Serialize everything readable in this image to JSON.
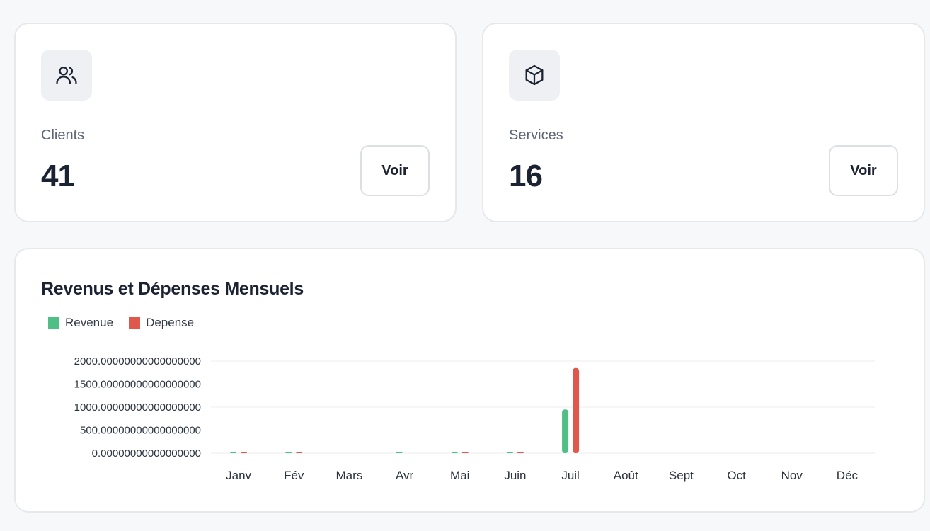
{
  "stats": {
    "clients": {
      "label": "Clients",
      "value": "41",
      "button": "Voir",
      "icon": "users-icon"
    },
    "services": {
      "label": "Services",
      "value": "16",
      "button": "Voir",
      "icon": "box-icon"
    }
  },
  "chart": {
    "title": "Revenus et Dépenses Mensuels",
    "legend": [
      {
        "name": "Revenue",
        "color": "#4fbf85"
      },
      {
        "name": "Depense",
        "color": "#e0574c"
      }
    ]
  },
  "chart_data": {
    "type": "bar",
    "title": "Revenus et Dépenses Mensuels",
    "xlabel": "",
    "ylabel": "",
    "categories": [
      "Janv",
      "Fév",
      "Mars",
      "Avr",
      "Mai",
      "Juin",
      "Juil",
      "Août",
      "Sept",
      "Oct",
      "Nov",
      "Déc"
    ],
    "series": [
      {
        "name": "Revenue",
        "color": "#4fbf85",
        "values": [
          30,
          30,
          0,
          30,
          30,
          20,
          950,
          0,
          0,
          0,
          0,
          0
        ]
      },
      {
        "name": "Depense",
        "color": "#e0574c",
        "values": [
          30,
          30,
          0,
          0,
          30,
          30,
          1850,
          0,
          0,
          0,
          0,
          0
        ]
      }
    ],
    "y_ticks": [
      "0.00000000000000000",
      "500.00000000000000000",
      "1000.00000000000000000",
      "1500.00000000000000000",
      "2000.00000000000000000"
    ],
    "y_tick_values": [
      0,
      500,
      1000,
      1500,
      2000
    ],
    "ylim": [
      0,
      2000
    ],
    "grid": true,
    "legend_position": "top-left"
  }
}
